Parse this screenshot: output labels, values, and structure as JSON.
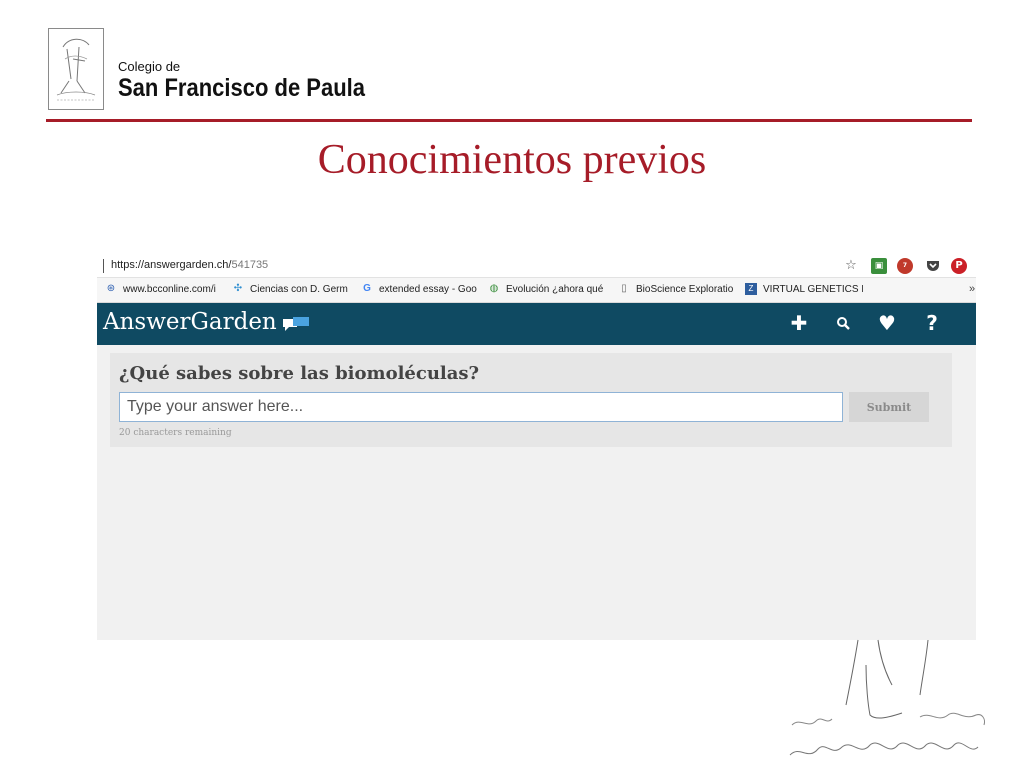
{
  "slide": {
    "school_prefix": "Colegio de",
    "school_name": "San Francisco de Paula",
    "title": "Conocimientos previos"
  },
  "browser": {
    "url_host": "https://answergarden.ch/",
    "url_path": "541735",
    "bookmarks": [
      {
        "icon": "globe-icon",
        "label": "www.bcconline.com/i"
      },
      {
        "icon": "pinwheel-icon",
        "label": "Ciencias con D. Germ"
      },
      {
        "icon": "google-icon",
        "label": "extended essay - Goo"
      },
      {
        "icon": "globe-color-icon",
        "label": "Evolución ¿ahora qué"
      },
      {
        "icon": "page-icon",
        "label": "BioScience Exploratio"
      },
      {
        "icon": "genetics-icon",
        "label": "VIRTUAL GENETICS L"
      }
    ],
    "more_bookmarks": "»",
    "abp_badge": "7"
  },
  "answergarden": {
    "brand": "AnswerGarden",
    "nav_icons": [
      "plus-icon",
      "search-icon",
      "heart-icon",
      "help-icon"
    ],
    "question": "¿Qué sabes sobre las biomoléculas?",
    "input_placeholder": "Type your answer here...",
    "submit_label": "Submit",
    "chars_remaining": "20 characters remaining"
  },
  "colors": {
    "accent": "#a61c28",
    "ag_bar": "#0f4a62",
    "panel": "#e6e6e6"
  }
}
